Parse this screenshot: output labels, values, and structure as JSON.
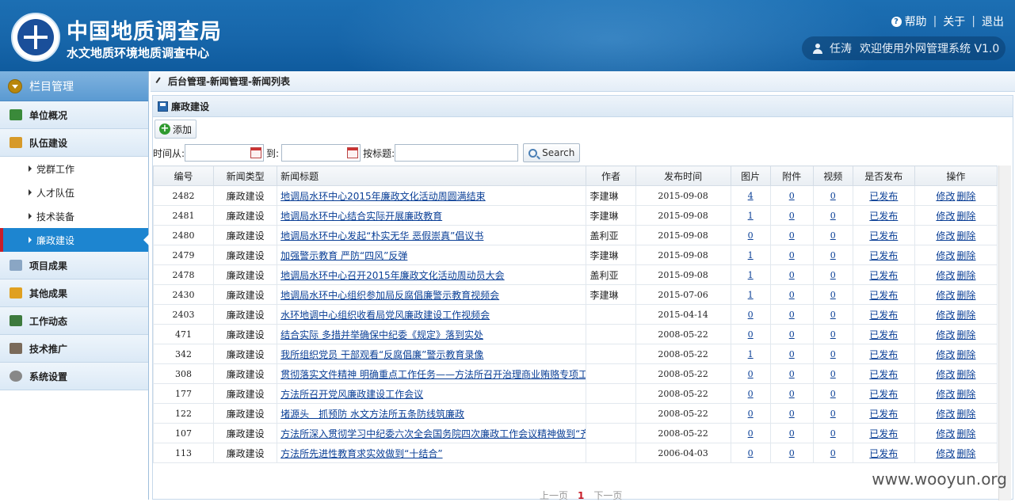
{
  "header": {
    "org_title": "中国地质调查局",
    "org_subtitle": "水文地质环境地质调查中心",
    "links": {
      "help": "帮助",
      "about": "关于",
      "logout": "退出"
    },
    "user_name": "任涛",
    "welcome": "欢迎使用外网管理系统 V1.0"
  },
  "sidebar": {
    "heading": "栏目管理",
    "items": [
      {
        "label": "单位概况",
        "icon": "org-chart-icon",
        "color": "#3a8a3a"
      },
      {
        "label": "队伍建设",
        "icon": "team-icon",
        "color": "#d79a2a"
      },
      {
        "label": "项目成果",
        "icon": "document-icon",
        "color": "#8aa6c4"
      },
      {
        "label": "其他成果",
        "icon": "trophy-icon",
        "color": "#e0a020"
      },
      {
        "label": "工作动态",
        "icon": "calendar-icon",
        "color": "#3d7a3d"
      },
      {
        "label": "技术推广",
        "icon": "tools-icon",
        "color": "#7a6a5a"
      },
      {
        "label": "系统设置",
        "icon": "gear-icon",
        "color": "#888888"
      }
    ],
    "sub_items": [
      {
        "label": "党群工作"
      },
      {
        "label": "人才队伍"
      },
      {
        "label": "技术装备"
      },
      {
        "label": "廉政建设"
      }
    ]
  },
  "breadcrumb": "后台管理-新闻管理-新闻列表",
  "panel_title": "廉政建设",
  "toolbar": {
    "add_label": "添加"
  },
  "filter": {
    "from_label": "时间从:",
    "to_label": "到:",
    "title_label": "按标题:",
    "search_label": "Search"
  },
  "table": {
    "headers": [
      "编号",
      "新闻类型",
      "新闻标题",
      "作者",
      "发布时间",
      "图片",
      "附件",
      "视频",
      "是否发布",
      "操作"
    ],
    "edit_label": "修改",
    "delete_label": "删除",
    "rows": [
      {
        "id": "2482",
        "type": "廉政建设",
        "title": "地调局水环中心2015年廉政文化活动周圆满结束",
        "author": "李建琳",
        "date": "2015-09-08",
        "images": "4",
        "attachments": "0",
        "videos": "0",
        "published": "已发布"
      },
      {
        "id": "2481",
        "type": "廉政建设",
        "title": "地调局水环中心结合实际开展廉政教育",
        "author": "李建琳",
        "date": "2015-09-08",
        "images": "1",
        "attachments": "0",
        "videos": "0",
        "published": "已发布"
      },
      {
        "id": "2480",
        "type": "廉政建设",
        "title": "地调局水环中心发起“朴实无华 恶假崇真”倡议书",
        "author": "盖利亚",
        "date": "2015-09-08",
        "images": "0",
        "attachments": "0",
        "videos": "0",
        "published": "已发布"
      },
      {
        "id": "2479",
        "type": "廉政建设",
        "title": "加强警示教育 严防“四风”反弹",
        "author": "李建琳",
        "date": "2015-09-08",
        "images": "1",
        "attachments": "0",
        "videos": "0",
        "published": "已发布"
      },
      {
        "id": "2478",
        "type": "廉政建设",
        "title": "地调局水环中心召开2015年廉政文化活动周动员大会",
        "author": "盖利亚",
        "date": "2015-09-08",
        "images": "1",
        "attachments": "0",
        "videos": "0",
        "published": "已发布"
      },
      {
        "id": "2430",
        "type": "廉政建设",
        "title": "地调局水环中心组织参加局反腐倡廉警示教育视频会",
        "author": "李建琳",
        "date": "2015-07-06",
        "images": "1",
        "attachments": "0",
        "videos": "0",
        "published": "已发布"
      },
      {
        "id": "2403",
        "type": "廉政建设",
        "title": "水环地调中心组织收看局党风廉政建设工作视频会",
        "author": "",
        "date": "2015-04-14",
        "images": "0",
        "attachments": "0",
        "videos": "0",
        "published": "已发布"
      },
      {
        "id": "471",
        "type": "廉政建设",
        "title": "结合实际 多措并举确保中纪委《规定》落到实处",
        "author": "",
        "date": "2008-05-22",
        "images": "0",
        "attachments": "0",
        "videos": "0",
        "published": "已发布"
      },
      {
        "id": "342",
        "type": "廉政建设",
        "title": "我所组织党员 干部观看“反腐倡廉”警示教育录像",
        "author": "",
        "date": "2008-05-22",
        "images": "1",
        "attachments": "0",
        "videos": "0",
        "published": "已发布"
      },
      {
        "id": "308",
        "type": "廉政建设",
        "title": "贯彻落实文件精神 明确重点工作任务——方法所召开治理商业贿赂专项工",
        "author": "",
        "date": "2008-05-22",
        "images": "0",
        "attachments": "0",
        "videos": "0",
        "published": "已发布"
      },
      {
        "id": "177",
        "type": "廉政建设",
        "title": "方法所召开党风廉政建设工作会议",
        "author": "",
        "date": "2008-05-22",
        "images": "0",
        "attachments": "0",
        "videos": "0",
        "published": "已发布"
      },
      {
        "id": "122",
        "type": "廉政建设",
        "title": "堵源头　抓预防 水文方法所五条防线筑廉政",
        "author": "",
        "date": "2008-05-22",
        "images": "0",
        "attachments": "0",
        "videos": "0",
        "published": "已发布"
      },
      {
        "id": "107",
        "type": "廉政建设",
        "title": "方法所深入贯彻学习中纪委六次全会国务院四次廉政工作会议精神做到“齐",
        "author": "",
        "date": "2008-05-22",
        "images": "0",
        "attachments": "0",
        "videos": "0",
        "published": "已发布"
      },
      {
        "id": "113",
        "type": "廉政建设",
        "title": "方法所先进性教育求实效做到“十结合”",
        "author": "",
        "date": "2006-04-03",
        "images": "0",
        "attachments": "0",
        "videos": "0",
        "published": "已发布"
      }
    ]
  },
  "pager": {
    "prev": "上一页",
    "current": "1",
    "next": "下一页"
  },
  "watermark": "www.wooyun.org"
}
